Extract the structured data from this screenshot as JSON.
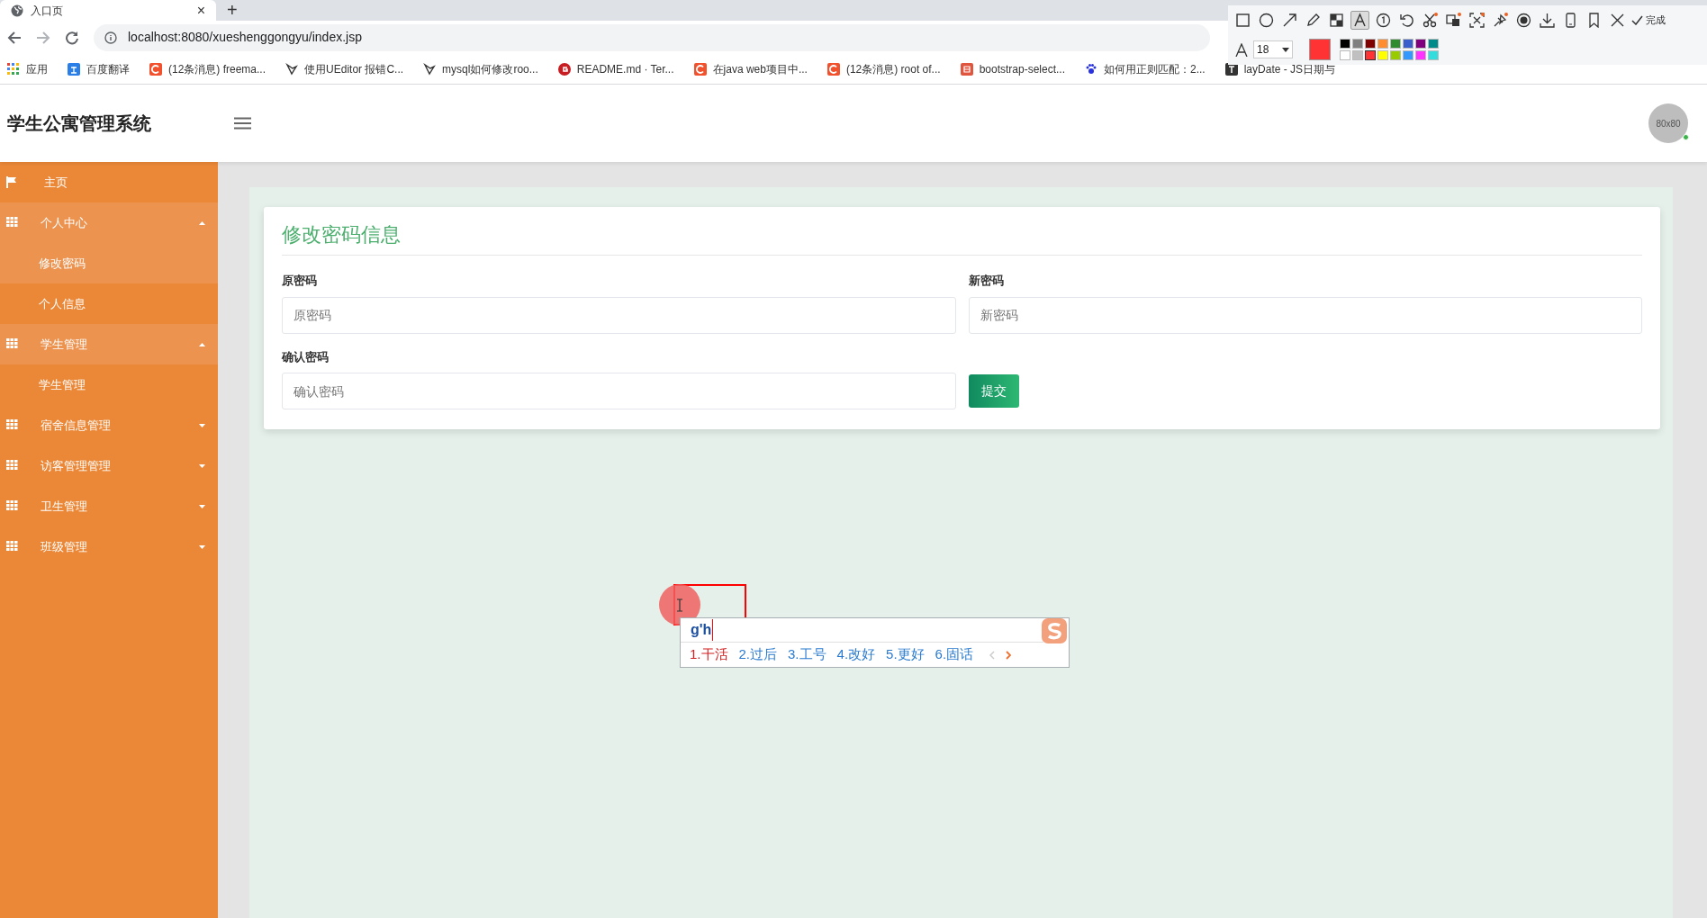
{
  "browser": {
    "tab": {
      "title": "入口页",
      "close": "×"
    },
    "new_tab": "+",
    "url": "localhost:8080/xueshenggongyu/index.jsp",
    "bookmarks": [
      {
        "kind": "apps",
        "label": "应用"
      },
      {
        "kind": "translate",
        "label": "百度翻译"
      },
      {
        "kind": "csdn",
        "label": "(12条消息) freema..."
      },
      {
        "kind": "bird",
        "label": "使用UEditor 报错C..."
      },
      {
        "kind": "bird",
        "label": "mysql如何修改roo..."
      },
      {
        "kind": "gitee",
        "label": "README.md · Ter..."
      },
      {
        "kind": "csdn",
        "label": "在java web项目中..."
      },
      {
        "kind": "csdn",
        "label": "(12条消息) root of..."
      },
      {
        "kind": "jian",
        "label": "bootstrap-select..."
      },
      {
        "kind": "paw",
        "label": "如何用正则匹配：2..."
      },
      {
        "kind": "doc",
        "label": "layDate - JS日期与"
      }
    ]
  },
  "app": {
    "title": "学生公寓管理系统",
    "avatar": "80x80"
  },
  "sidebar": [
    {
      "kind": "link",
      "label": "主页",
      "expanded": false
    },
    {
      "kind": "group",
      "label": "个人中心",
      "expanded": true,
      "children": [
        {
          "label": "修改密码",
          "selected": true
        },
        {
          "label": "个人信息",
          "selected": false
        }
      ]
    },
    {
      "kind": "group",
      "label": "学生管理",
      "expanded": true,
      "children": [
        {
          "label": "学生管理",
          "selected": false
        }
      ]
    },
    {
      "kind": "group",
      "label": "宿舍信息管理",
      "expanded": false
    },
    {
      "kind": "group",
      "label": "访客管理管理",
      "expanded": false
    },
    {
      "kind": "group",
      "label": "卫生管理",
      "expanded": false
    },
    {
      "kind": "group",
      "label": "班级管理",
      "expanded": false
    }
  ],
  "form": {
    "title": "修改密码信息",
    "fields": [
      {
        "label": "原密码",
        "placeholder": "原密码"
      },
      {
        "label": "新密码",
        "placeholder": "新密码"
      },
      {
        "label": "确认密码",
        "placeholder": "确认密码"
      }
    ],
    "submit": "提交"
  },
  "ime": {
    "input": "g'h",
    "candidates": [
      {
        "label": "1.干活",
        "selected": true
      },
      {
        "label": "2.过后",
        "selected": false
      },
      {
        "label": "3.工号",
        "selected": false
      },
      {
        "label": "4.改好",
        "selected": false
      },
      {
        "label": "5.更好",
        "selected": false
      },
      {
        "label": "6.固话",
        "selected": false
      }
    ]
  },
  "capture_toolbar": {
    "tools": [
      {
        "kind": "rect",
        "selected": false
      },
      {
        "kind": "ellipse",
        "selected": false
      },
      {
        "kind": "arrow",
        "selected": false
      },
      {
        "kind": "pencil",
        "selected": false
      },
      {
        "kind": "mosaic",
        "selected": false
      },
      {
        "kind": "text",
        "selected": true
      },
      {
        "kind": "number",
        "selected": false
      },
      {
        "kind": "undo",
        "selected": false
      },
      {
        "kind": "scissors",
        "selected": false
      },
      {
        "kind": "translate",
        "selected": false
      },
      {
        "kind": "ocr",
        "selected": false
      },
      {
        "kind": "pin",
        "selected": false
      },
      {
        "kind": "record",
        "selected": false
      },
      {
        "kind": "download",
        "selected": false
      },
      {
        "kind": "phone",
        "selected": false
      },
      {
        "kind": "bookmark",
        "selected": false
      },
      {
        "kind": "close",
        "selected": false
      }
    ],
    "done": "完成",
    "font_size": "18",
    "palette": [
      {
        "color": "#000000",
        "selected": false
      },
      {
        "color": "#808080",
        "selected": false
      },
      {
        "color": "#800000",
        "selected": false
      },
      {
        "color": "#ff8c2e",
        "selected": false
      },
      {
        "color": "#2e8b2e",
        "selected": false
      },
      {
        "color": "#3a5fcd",
        "selected": false
      },
      {
        "color": "#800080",
        "selected": false
      },
      {
        "color": "#008b8b",
        "selected": false
      },
      {
        "color": "#ffffff",
        "selected": false
      },
      {
        "color": "#c0c0c0",
        "selected": false
      },
      {
        "color": "#ff3333",
        "selected": true
      },
      {
        "color": "#ffff00",
        "selected": false
      },
      {
        "color": "#99cc00",
        "selected": false
      },
      {
        "color": "#3399ff",
        "selected": false
      },
      {
        "color": "#ff33ff",
        "selected": false
      },
      {
        "color": "#33dddd",
        "selected": false
      }
    ]
  }
}
